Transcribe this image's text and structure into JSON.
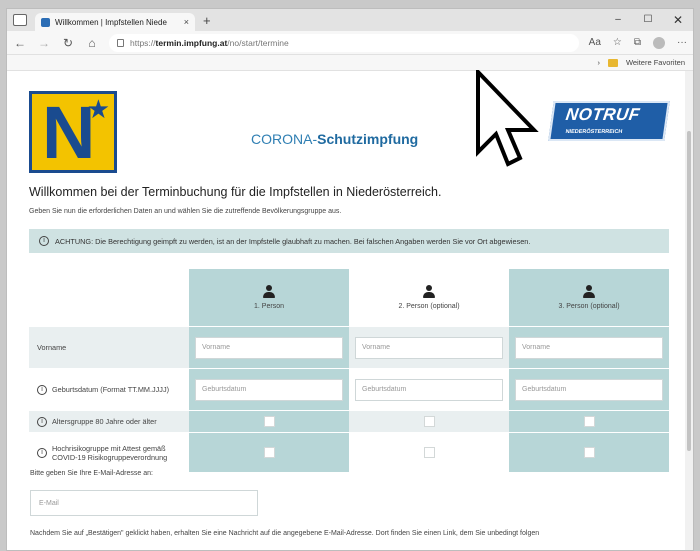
{
  "browser": {
    "tab_title": "Willkommen | Impfstellen Niede",
    "tab_close": "×",
    "new_tab": "+",
    "url_prefix": "https://",
    "url_domain": "termin.impfung.at",
    "url_path": "/no/start/termine",
    "favorites_label": "Weitere Favoriten",
    "win_min": "–",
    "win_max": "☐",
    "win_close": "✕",
    "more": "···"
  },
  "header": {
    "headline_prefix": "CORONA-",
    "headline_bold": "Schutzimpfung",
    "notruf_title": "NOTRUF",
    "notruf_sub": "NIEDERÖSTERREICH"
  },
  "page": {
    "welcome": "Willkommen bei der Terminbuchung für die Impfstellen in Niederösterreich.",
    "instructions": "Geben Sie nun die erforderlichen Daten an und wählen Sie die zutreffende Bevölkerungsgruppe aus.",
    "notice": "ACHTUNG: Die Berechtigung geimpft zu werden, ist an der Impfstelle glaubhaft zu machen. Bei falschen Angaben werden Sie vor Ort abgewiesen."
  },
  "form": {
    "persons": [
      "1. Person",
      "2. Person (optional)",
      "3. Person (optional)"
    ],
    "rows": {
      "vorname_label": "Vorname",
      "vorname_placeholder": "Vorname",
      "birth_label": "Geburtsdatum (Format TT.MM.JJJJ)",
      "birth_placeholder": "Geburtsdatum",
      "age_label": "Altersgruppe 80 Jahre oder älter",
      "risk_label": "Hochrisikogruppe mit Attest gemäß COVID-19 Risikogruppeverordnung"
    },
    "email_label": "Bitte geben Sie Ihre E-Mail-Adresse an:",
    "email_placeholder": "E-Mail",
    "after_text": "Nachdem Sie auf „Bestätigen\" geklickt haben, erhalten Sie eine Nachricht auf die angegebene E-Mail-Adresse. Dort finden Sie einen Link, dem Sie unbedingt folgen"
  }
}
